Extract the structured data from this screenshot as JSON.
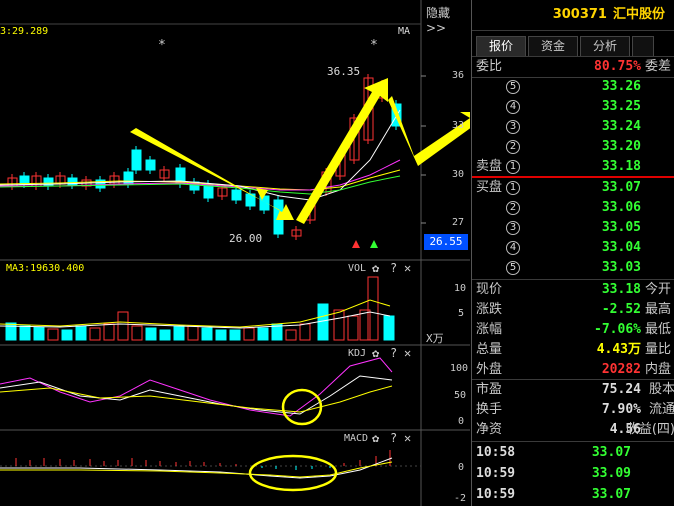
{
  "colors": {
    "up": "#ff3333",
    "down": "#00ffff",
    "green": "#33ff33",
    "yellow": "#ffff00",
    "white": "#ffffff",
    "magenta": "#ff33ff",
    "red_line": "#e00000"
  },
  "header": {
    "hide_label": "隐藏>>",
    "ma_value": "3:29.289",
    "ma_label": "MA"
  },
  "main_chart": {
    "price_axis": [
      "36",
      "33",
      "30",
      "27"
    ],
    "current_price_tag": "26.55",
    "high_label": "36.35",
    "low_label": "26.00",
    "star": "*"
  },
  "volume_panel": {
    "ma_value": "MA3:19630.400",
    "name": "VOL",
    "axis": [
      "10",
      "5"
    ],
    "unit": "X万"
  },
  "kdj_panel": {
    "name": "KDJ",
    "axis": [
      "100",
      "50",
      "0"
    ]
  },
  "macd_panel": {
    "name": "MACD",
    "axis": [
      "0",
      "-2"
    ]
  },
  "panel_icons": {
    "gear": "✿",
    "help": "?",
    "close": "✕"
  },
  "stock": {
    "code": "300371",
    "name": "汇中股份"
  },
  "tabs": [
    "报价",
    "资金",
    "分析",
    ""
  ],
  "weibi": {
    "label": "委比",
    "value": "80.75%",
    "label2": "委差"
  },
  "sell_levels": [
    {
      "label": "",
      "num": "5",
      "price": "33.26"
    },
    {
      "label": "",
      "num": "4",
      "price": "33.25"
    },
    {
      "label": "",
      "num": "3",
      "price": "33.24"
    },
    {
      "label": "",
      "num": "2",
      "price": "33.20"
    },
    {
      "label": "卖盘",
      "num": "1",
      "price": "33.18"
    }
  ],
  "buy_levels": [
    {
      "label": "买盘",
      "num": "1",
      "price": "33.07"
    },
    {
      "label": "",
      "num": "2",
      "price": "33.06"
    },
    {
      "label": "",
      "num": "3",
      "price": "33.05"
    },
    {
      "label": "",
      "num": "4",
      "price": "33.04"
    },
    {
      "label": "",
      "num": "5",
      "price": "33.03"
    }
  ],
  "quote_rows": [
    {
      "label": "现价",
      "value": "33.18",
      "label2": "今开",
      "color": "#33ff33"
    },
    {
      "label": "涨跌",
      "value": "-2.52",
      "label2": "最高",
      "color": "#33ff33"
    },
    {
      "label": "涨幅",
      "value": "-7.06%",
      "label2": "最低",
      "color": "#33ff33"
    },
    {
      "label": "总量",
      "value": "4.43万",
      "label2": "量比",
      "color": "#ffff00"
    },
    {
      "label": "外盘",
      "value": "20282",
      "label2": "内盘",
      "color": "#ff3333"
    }
  ],
  "fund_rows": [
    {
      "label": "市盈",
      "value": "75.24",
      "label2": "股本"
    },
    {
      "label": "换手",
      "value": "7.90%",
      "label2": "流通"
    },
    {
      "label": "净资",
      "value": "4.56",
      "label2": "收益(四)"
    }
  ],
  "ticks": [
    {
      "time": "10:58",
      "price": "33.07"
    },
    {
      "time": "10:59",
      "price": "33.09"
    },
    {
      "time": "10:59",
      "price": "33.07"
    }
  ]
}
